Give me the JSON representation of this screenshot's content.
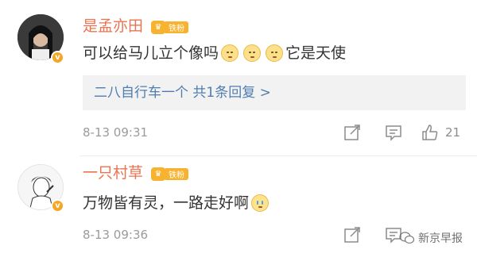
{
  "comments": [
    {
      "username": "是孟亦田",
      "fan_badge": "铁粉",
      "text_before": "可以给马儿立个像吗",
      "emojis": [
        "pensive-face",
        "pensive-face",
        "pensive-face"
      ],
      "text_after": "它是天使",
      "reply_preview": "二八自行车一个  共1条回复 >",
      "time": "8-13 09:31",
      "like_count": "21"
    },
    {
      "username": "一只村草",
      "fan_badge": "铁粉",
      "text_before": "万物皆有灵，一路走好啊",
      "emojis": [
        "crying-face"
      ],
      "time": "8-13 09:36"
    }
  ],
  "watermark": {
    "text": "新京早报",
    "icon": "wechat-icon"
  },
  "colors": {
    "username": "#eb7350",
    "badge": "#f7b22f",
    "link": "#507daf",
    "meta": "#9b9b9b"
  }
}
